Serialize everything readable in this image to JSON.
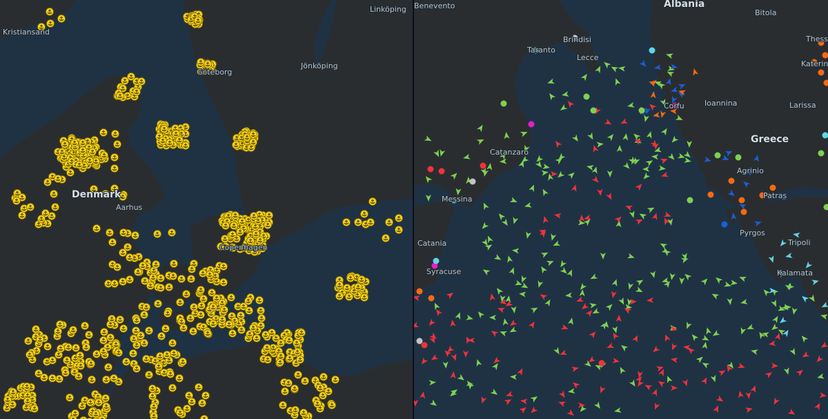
{
  "left_map": {
    "country_labels": [
      "Denmark"
    ],
    "city_labels": [
      "Kristiansand",
      "Göteborg",
      "Jönköping",
      "Linköping",
      "Aarhus",
      "Copenhagen"
    ],
    "marker_type": "anchor-icon",
    "marker_color": "#f4d21c"
  },
  "right_map": {
    "country_labels": [
      "Albania",
      "Greece"
    ],
    "city_labels": [
      "Bitola",
      "Thessaloniki",
      "Katerini",
      "Brindisi",
      "Lecce",
      "Taranto",
      "Ioannina",
      "Larissa",
      "Corfu",
      "Catanzaro",
      "Agrinio",
      "Patras",
      "Messina",
      "Catania",
      "Syracuse",
      "Pyrgos",
      "Tripoli",
      "Kalamata",
      "Benevento"
    ],
    "vessel_colors": {
      "green": "#7ed14f",
      "red": "#f0323c",
      "orange": "#f56a12",
      "blue": "#1a5fd6",
      "cyan": "#5fd6e8",
      "magenta": "#e81ec8",
      "grey": "#c4c4c4"
    }
  },
  "colors": {
    "sea": "#1f3244",
    "land": "#2a2d30",
    "divider": "#0c0f1a"
  }
}
